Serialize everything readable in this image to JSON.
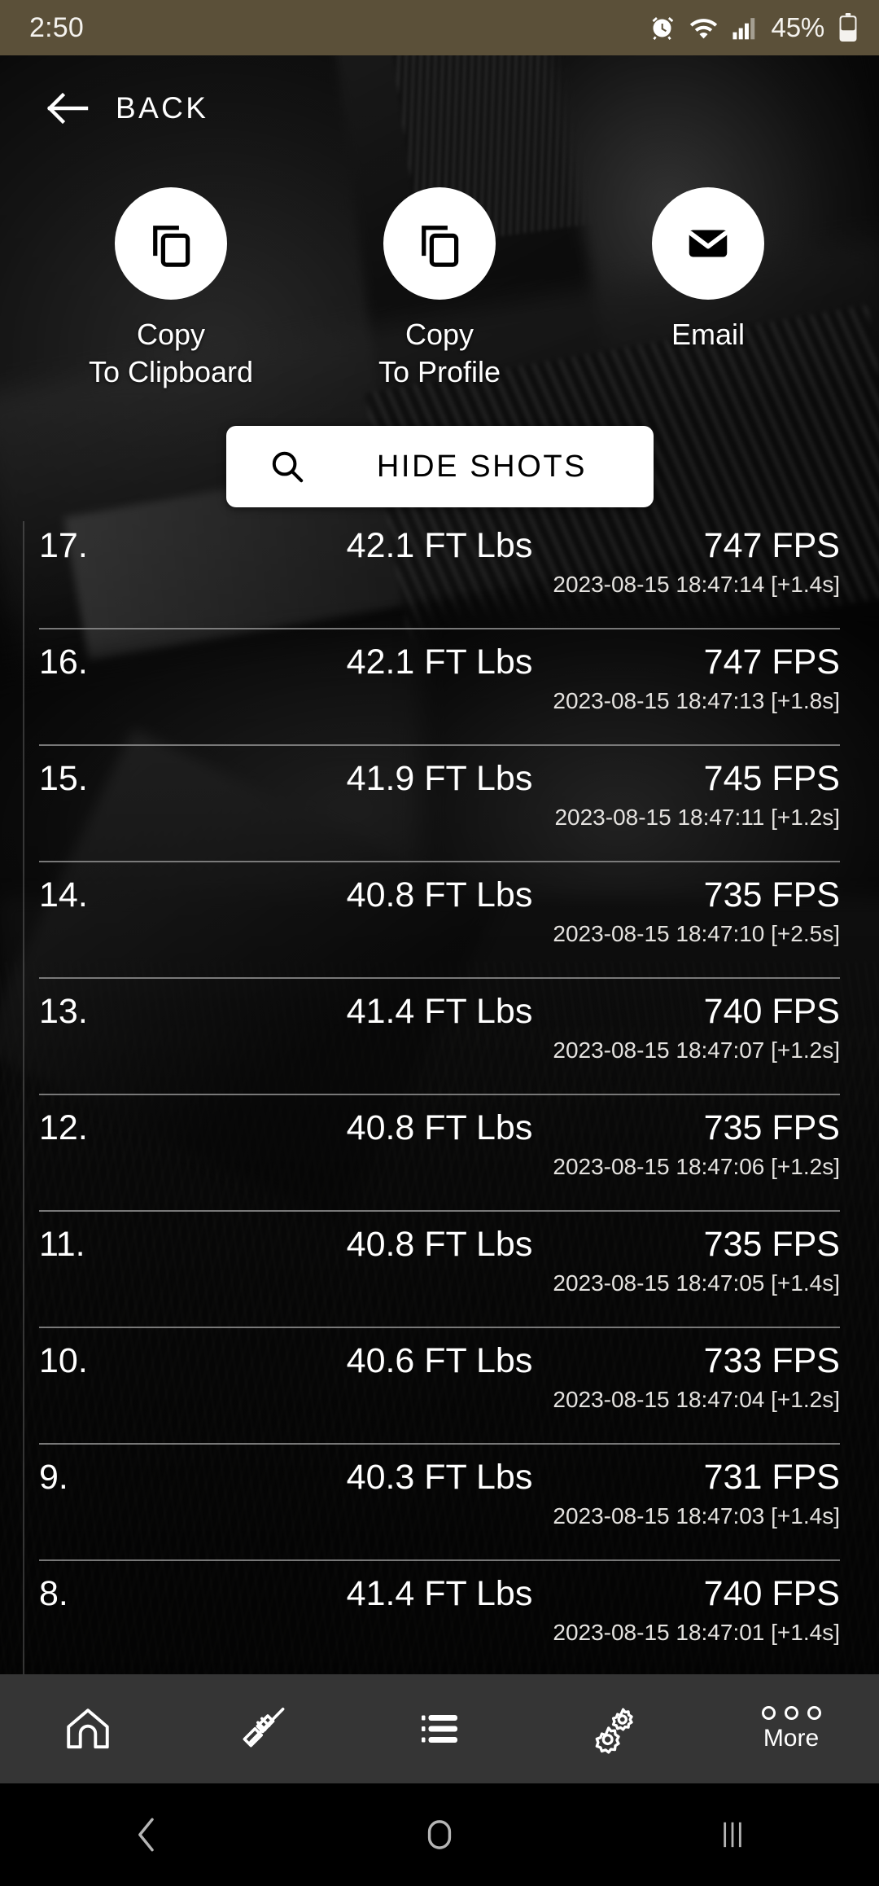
{
  "statusbar": {
    "clock": "2:50",
    "battery_pct": "45%",
    "icons": [
      "alarm-icon",
      "wifi-icon",
      "signal-icon",
      "battery-icon"
    ]
  },
  "header": {
    "back_label": "BACK",
    "back_icon": "arrow-left-icon"
  },
  "actions": [
    {
      "label": "Copy\nTo Clipboard",
      "icon": "copy-icon"
    },
    {
      "label": "Copy\nTo Profile",
      "icon": "copy-icon"
    },
    {
      "label": "Email",
      "icon": "envelope-icon"
    }
  ],
  "toggle": {
    "label": "HIDE SHOTS",
    "icon": "search-icon"
  },
  "shots": [
    {
      "index": "17.",
      "energy": "42.1 FT Lbs",
      "speed": "747 FPS",
      "timestamp": "2023-08-15 18:47:14 [+1.4s]"
    },
    {
      "index": "16.",
      "energy": "42.1 FT Lbs",
      "speed": "747 FPS",
      "timestamp": "2023-08-15 18:47:13 [+1.8s]"
    },
    {
      "index": "15.",
      "energy": "41.9 FT Lbs",
      "speed": "745 FPS",
      "timestamp": "2023-08-15 18:47:11 [+1.2s]"
    },
    {
      "index": "14.",
      "energy": "40.8 FT Lbs",
      "speed": "735 FPS",
      "timestamp": "2023-08-15 18:47:10 [+2.5s]"
    },
    {
      "index": "13.",
      "energy": "41.4 FT Lbs",
      "speed": "740 FPS",
      "timestamp": "2023-08-15 18:47:07 [+1.2s]"
    },
    {
      "index": "12.",
      "energy": "40.8 FT Lbs",
      "speed": "735 FPS",
      "timestamp": "2023-08-15 18:47:06 [+1.2s]"
    },
    {
      "index": "11.",
      "energy": "40.8 FT Lbs",
      "speed": "735 FPS",
      "timestamp": "2023-08-15 18:47:05 [+1.4s]"
    },
    {
      "index": "10.",
      "energy": "40.6 FT Lbs",
      "speed": "733 FPS",
      "timestamp": "2023-08-15 18:47:04 [+1.2s]"
    },
    {
      "index": "9.",
      "energy": "40.3 FT Lbs",
      "speed": "731 FPS",
      "timestamp": "2023-08-15 18:47:03 [+1.4s]"
    },
    {
      "index": "8.",
      "energy": "41.4 FT Lbs",
      "speed": "740 FPS",
      "timestamp": "2023-08-15 18:47:01 [+1.4s]"
    }
  ],
  "tabbar": [
    {
      "name": "home",
      "icon": "home-icon",
      "label": ""
    },
    {
      "name": "rifle",
      "icon": "rifle-icon",
      "label": ""
    },
    {
      "name": "list",
      "icon": "list-icon",
      "label": ""
    },
    {
      "name": "settings",
      "icon": "gears-icon",
      "label": ""
    },
    {
      "name": "more",
      "icon": "more-dots-icon",
      "label": "More"
    }
  ],
  "navbar": {
    "back": "nav-back-icon",
    "home": "nav-home-icon",
    "recents": "nav-recents-icon"
  },
  "colors": {
    "statusbar_bg": "#5b5039",
    "tabbar_bg": "#353535",
    "accent_white": "#ffffff",
    "rule": "#8c8c8c"
  }
}
